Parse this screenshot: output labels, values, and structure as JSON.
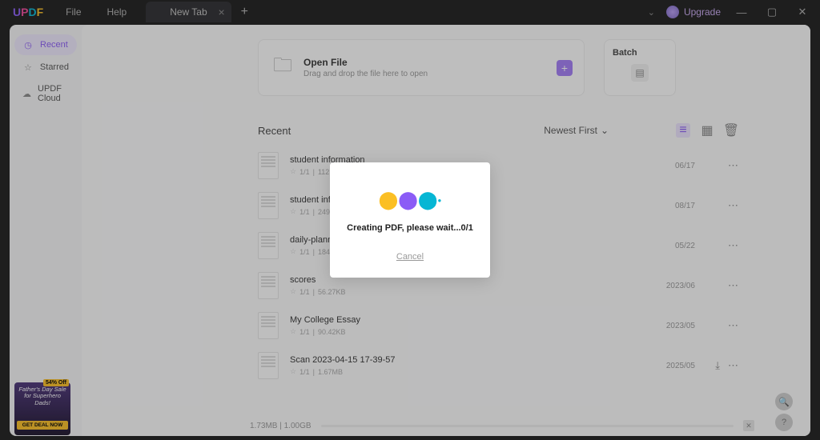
{
  "titlebar": {
    "logo": {
      "u": "U",
      "p": "P",
      "d": "D",
      "f": "F"
    },
    "menu": {
      "file": "File",
      "help": "Help"
    },
    "tab_label": "New Tab",
    "upgrade": "Upgrade"
  },
  "sidebar": {
    "recent": "Recent",
    "starred": "Starred",
    "cloud": "UPDF Cloud"
  },
  "openfile": {
    "title": "Open File",
    "subtitle": "Drag and drop the file here to open"
  },
  "batch": {
    "title": "Batch"
  },
  "list": {
    "header": "Recent",
    "sort": "Newest First"
  },
  "files": [
    {
      "name": "student information",
      "pages": "1/1",
      "size": "112.43KB",
      "date": "06/17",
      "cloud": false
    },
    {
      "name": "student information",
      "pages": "1/1",
      "size": "249.99KB",
      "date": "08/17",
      "cloud": false
    },
    {
      "name": "daily-planner-03",
      "pages": "1/1",
      "size": "184.33KB",
      "date": "05/22",
      "cloud": false
    },
    {
      "name": "scores",
      "pages": "1/1",
      "size": "56.27KB",
      "date": "2023/06",
      "cloud": false
    },
    {
      "name": "My College Essay",
      "pages": "1/1",
      "size": "90.42KB",
      "date": "2023/05",
      "cloud": false
    },
    {
      "name": "Scan 2023-04-15 17-39-57",
      "pages": "1/1",
      "size": "1.67MB",
      "date": "2025/05",
      "cloud": true
    }
  ],
  "status": {
    "used": "1.73MB",
    "total": "1.00GB"
  },
  "promo": {
    "badge": "54% Off",
    "line1": "Father's Day Sale",
    "line2": "for Superhero",
    "line3": "Dads!",
    "cta": "GET DEAL NOW"
  },
  "modal": {
    "message": "Creating PDF, please wait...0/1",
    "cancel": "Cancel"
  }
}
